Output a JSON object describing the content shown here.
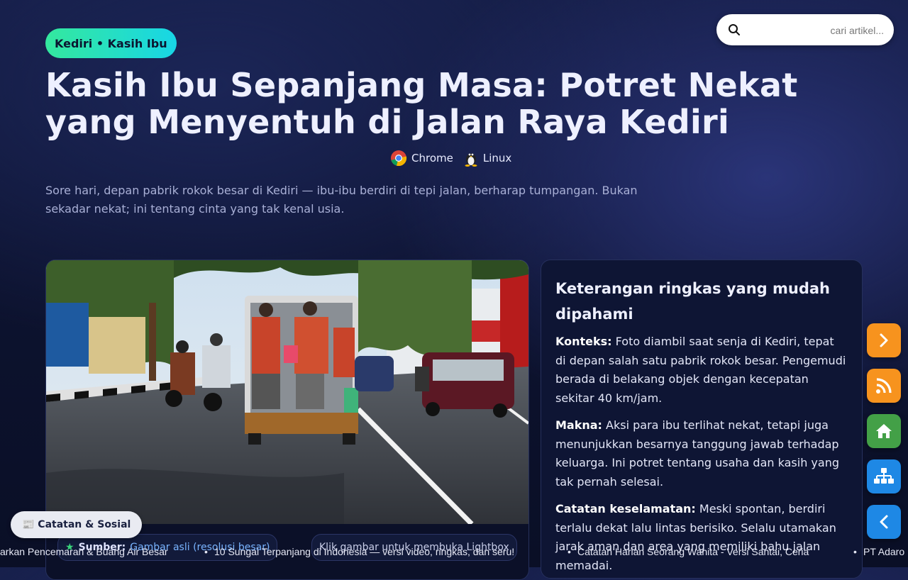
{
  "header": {
    "tag": "Kediri • Kasih Ibu",
    "title_line1": "Kasih Ibu Sepanjang Masa: Potret Nekat",
    "title_line2": "yang Menyentuh di Jalan Raya Kediri",
    "badges": [
      {
        "label": "Chrome",
        "icon": "chrome-icon"
      },
      {
        "label": "Linux",
        "icon": "tux-icon"
      }
    ],
    "lead": "Sore hari, depan pabrik rokok besar di Kediri — ibu-ibu berdiri di tepi jalan, berharap tumpangan. Bukan sekadar nekat; ini tentang cinta yang tak kenal usia."
  },
  "search": {
    "placeholder": "cari artikel..."
  },
  "photo_card": {
    "source_key": "Sumber:",
    "source_link": "Gambar asli (resolusi besar)",
    "hint": "Klik gambar untuk membuka Lightbox"
  },
  "info": {
    "title": "Keterangan ringkas yang mudah dipahami",
    "items": [
      {
        "key": "Konteks:",
        "text": " Foto diambil saat senja di Kediri, tepat di depan salah satu pabrik rokok besar. Pengemudi berada di belakang objek dengan kecepatan sekitar 40 km/jam."
      },
      {
        "key": "Makna:",
        "text": " Aksi para ibu terlihat nekat, tetapi juga menunjukkan besarnya tanggung jawab terhadap keluarga. Ini potret tentang usaha dan kasih yang tak pernah selesai."
      },
      {
        "key": "Catatan keselamatan:",
        "text": " Meski spontan, berdiri terlalu dekat lalu lintas berisiko. Selalu utamakan jarak aman dan area yang memiliki bahu jalan memadai."
      }
    ]
  },
  "note_button": {
    "label": "📰 Catatan & Sosial"
  },
  "ticker": [
    "arkan Pencemaran & Buang Air Besar",
    "10 Sungai Terpanjang di Indonesia — versi video, ringkas, dan seru!",
    "Catatan Harian Seorang Wanita - Versi Santai, Ceria",
    "PT Adaro"
  ],
  "colors": {
    "fab_next": "#f7931e",
    "fab_rss": "#f7931e",
    "fab_home": "#43a047",
    "fab_sitemap": "#1e88e5",
    "fab_back": "#1e88e5"
  }
}
